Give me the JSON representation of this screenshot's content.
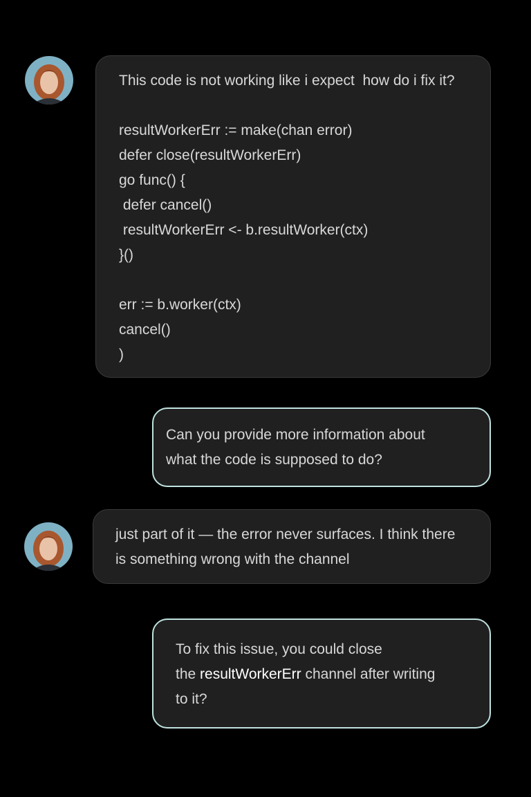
{
  "messages": [
    {
      "role": "user",
      "avatar": "user-avatar",
      "lines": [
        "This code is not working like i expect  how do i fix it?",
        "",
        "resultWorkerErr := make(chan error)",
        "defer close(resultWorkerErr)",
        "go func() {",
        " defer cancel()",
        " resultWorkerErr <- b.resultWorker(ctx)",
        "}()",
        "",
        "err := b.worker(ctx)",
        "cancel()",
        ")"
      ]
    },
    {
      "role": "assistant",
      "lines": [
        "Can you provide more information about",
        "what the code is supposed to do?"
      ]
    },
    {
      "role": "user",
      "avatar": "user-avatar",
      "lines": [
        "just part of it — the error never surfaces. I think there",
        "is something wrong with the channel"
      ]
    },
    {
      "role": "assistant",
      "line1": "To fix this issue, you could close",
      "line2_pre": "the ",
      "line2_code": "resultWorkerErr",
      "line2_post": " channel after writing",
      "line3": "to it?"
    }
  ],
  "colors": {
    "background": "#000000",
    "bubble": "#202020",
    "assistant_border": "#bfe3e0",
    "text": "#d8d8d8",
    "highlight": "#ffffff"
  }
}
